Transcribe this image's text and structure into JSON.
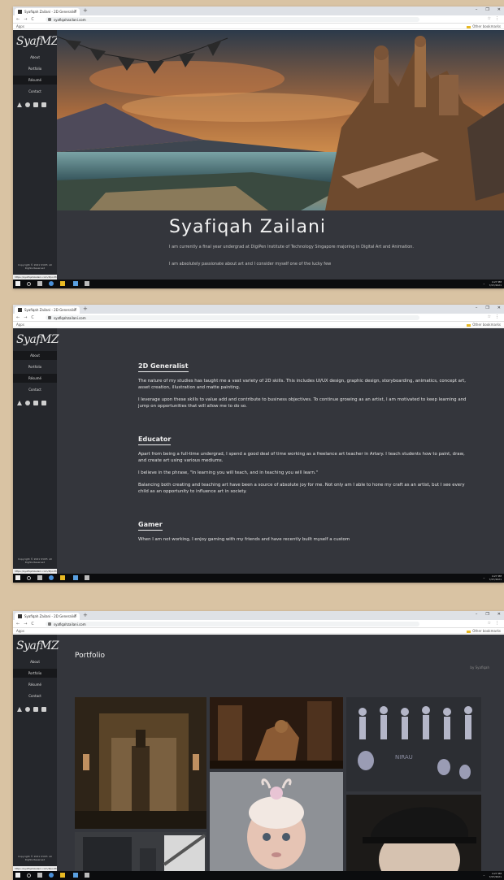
{
  "browser": {
    "tab_title": "Syafiqah Zailani - 2D Generalist",
    "url": "syafiqahzailani.com",
    "apps_label": "Apps",
    "other_bookmarks": "Other bookmarks",
    "tab_close": "×",
    "tab_new": "+",
    "win_min": "–",
    "win_max": "❐",
    "win_close": "✕",
    "nav_back": "←",
    "nav_forward": "→",
    "nav_reload": "C",
    "bookmark_star": "☆",
    "menu": "⋮"
  },
  "sidebar": {
    "logo": "SyafMZ",
    "items": [
      {
        "label": "About"
      },
      {
        "label": "Portfolio"
      },
      {
        "label": "Résumé"
      },
      {
        "label": "Contact"
      }
    ],
    "socials": [
      "artstation-icon",
      "dribbble-icon",
      "linkedin-icon",
      "mail-icon"
    ],
    "copyright": "Copyright © 2021 SYAFI. All Rights Reserved",
    "status_url": "https://syafiqahzailani.com/#portfolio"
  },
  "hero": {
    "name": "Syafiqah Zailani",
    "para1": "I am currently a final year undergrad at DigiPen Institute of Technology Singapore majoring in Digital Art and Animation.",
    "para2": "I am absolutely passionate about art and I consider myself one of the lucky few"
  },
  "about": {
    "sections": [
      {
        "title": "2D Generalist",
        "paragraphs": [
          "The nature of my studies has taught me a vast variety of 2D skills. This includes UI/UX design, graphic design, storyboarding, animatics, concept art, asset creation, illustration and matte painting.",
          "I leverage upon these skills to value add and contribute to business objectives. To continue growing as an artist, I am motivated to keep learning and jump on opportunities that will allow me to do so."
        ]
      },
      {
        "title": "Educator",
        "paragraphs": [
          "Apart from being a full-time undergrad, I spend a good deal of time working as a freelance art teacher in Artary. I teach students how to paint, draw, and create art using various mediums.",
          "I believe in the phrase, \"In learning you will teach, and in teaching you will learn.\"",
          "Balancing both creating and teaching art have been a source of absolute joy for me. Not only am I able to hone my craft as an artist, but I see every child as an opportunity to influence art in society."
        ]
      },
      {
        "title": "Gamer",
        "paragraphs": [
          "When I am not working, I enjoy gaming with my friends and have recently built myself a custom"
        ]
      }
    ]
  },
  "portfolio": {
    "title": "Portfolio",
    "credit": "by Syafiqah",
    "character_sheet_label": "NIRAU"
  },
  "taskbar": {
    "time": "4:27 PM",
    "date": "7/27/2021",
    "tray_arrow": "^"
  },
  "colors": {
    "site_bg": "#34363c",
    "sidebar_bg": "#25272c",
    "nav_active": "#17181b",
    "page_bg": "#d9c3a3",
    "taskbar_bg": "#0b0c0e"
  }
}
